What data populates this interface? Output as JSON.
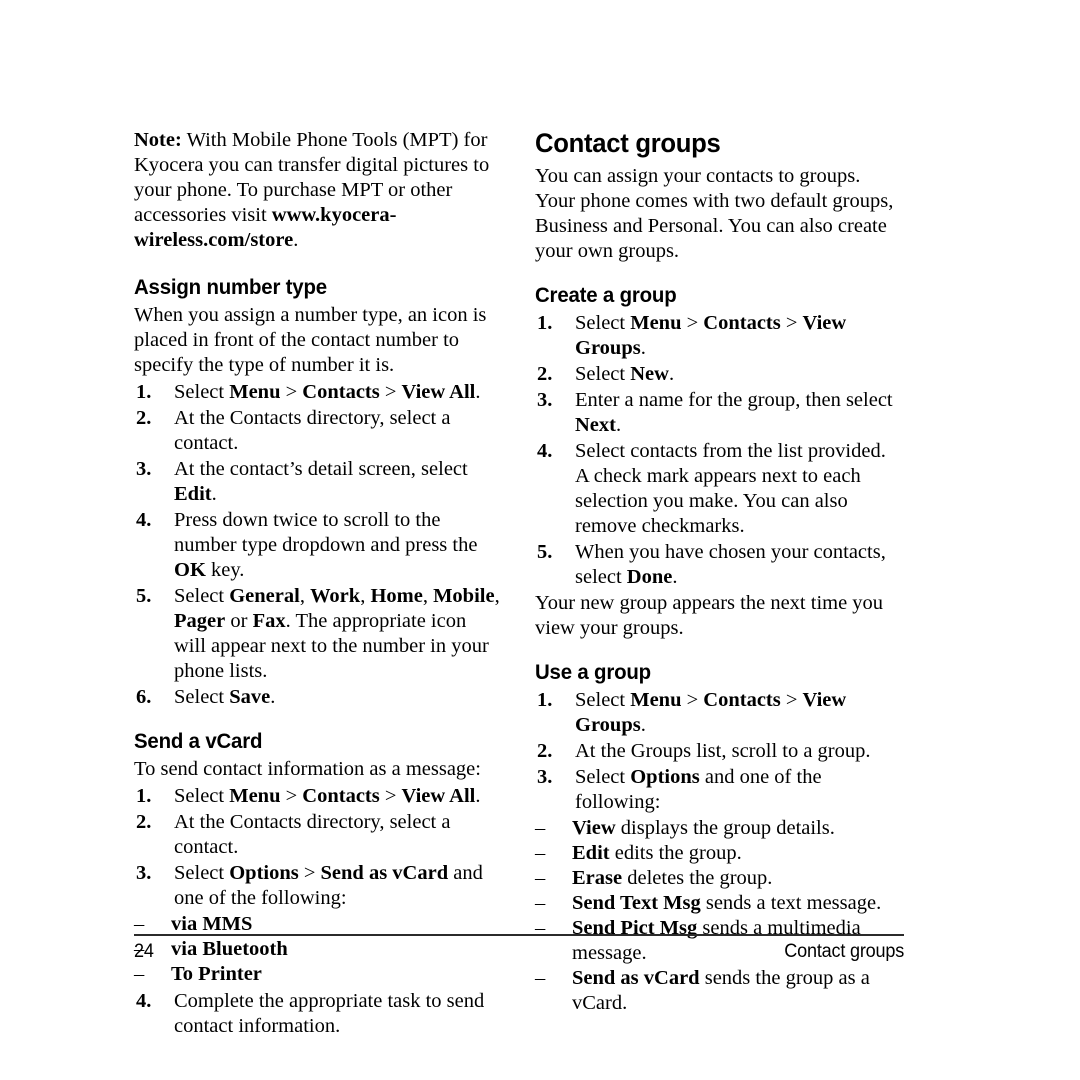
{
  "page": {
    "number": "24",
    "running_head": "Contact groups"
  },
  "left_column": {
    "note": {
      "label": "Note:",
      "text_before_url": " With Mobile Phone Tools (MPT) for Kyocera you can transfer digital pictures to your phone. To purchase MPT or other accessories visit ",
      "url": "www.kyocera-wireless.com/store",
      "text_after_url": "."
    },
    "assign_number_type": {
      "heading": "Assign number type",
      "intro": "When you assign a number type, an icon is placed in front of the contact number to specify the type of number it is.",
      "steps": [
        {
          "num": "1.",
          "html": "Select <b>Menu</b> > <b>Contacts</b> > <b>View All</b>."
        },
        {
          "num": "2.",
          "html": "At the Contacts directory, select a contact."
        },
        {
          "num": "3.",
          "html": "At the contact’s detail screen, select <b>Edit</b>."
        },
        {
          "num": "4.",
          "html": "Press down twice to scroll to the number type dropdown and press the <b>OK</b> key."
        },
        {
          "num": "5.",
          "html": "Select <b>General</b>, <b>Work</b>, <b>Home</b>, <b>Mobile</b>, <b>Pager</b> or <b>Fax</b>. The appropriate icon will appear next to the number in your phone lists."
        },
        {
          "num": "6.",
          "html": "Select <b>Save</b>."
        }
      ]
    },
    "send_a_vcard": {
      "heading": "Send a vCard",
      "intro": "To send contact information as a message:",
      "steps": [
        {
          "num": "1.",
          "html": "Select <b>Menu</b> > <b>Contacts</b> > <b>View All</b>."
        },
        {
          "num": "2.",
          "html": "At the Contacts directory, select a contact."
        },
        {
          "num": "3.",
          "html": "Select <b>Options</b> > <b>Send as vCard</b> and one of the following:"
        }
      ],
      "sub_options": [
        {
          "dash": "–",
          "html": "<b>via MMS</b>"
        },
        {
          "dash": "–",
          "html": "<b>via Bluetooth</b>"
        },
        {
          "dash": "–",
          "html": "<b>To Printer</b>"
        }
      ],
      "final_step": {
        "num": "4.",
        "html": "Complete the appropriate task to send contact information."
      }
    }
  },
  "right_column": {
    "title": "Contact groups",
    "intro": "You can assign your contacts to groups. Your phone comes with two default groups, Business and Personal. You can also create your own groups.",
    "create_a_group": {
      "heading": "Create a group",
      "steps": [
        {
          "num": "1.",
          "html": "Select <b>Menu</b> > <b>Contacts</b> > <b>View Groups</b>."
        },
        {
          "num": "2.",
          "html": "Select <b>New</b>."
        },
        {
          "num": "3.",
          "html": "Enter a name for the group, then select <b>Next</b>."
        },
        {
          "num": "4.",
          "html": "Select contacts from the list provided. A check mark appears next to each selection you make. You can also remove checkmarks."
        },
        {
          "num": "5.",
          "html": "When you have chosen your contacts, select <b>Done</b>."
        }
      ],
      "closing": "Your new group appears the next time you view your groups."
    },
    "use_a_group": {
      "heading": "Use a group",
      "steps": [
        {
          "num": "1.",
          "html": "Select <b>Menu</b> > <b>Contacts</b> > <b>View Groups</b>."
        },
        {
          "num": "2.",
          "html": "At the Groups list, scroll to a group."
        },
        {
          "num": "3.",
          "html": "Select <b>Options</b> and one of the following:"
        }
      ],
      "sub_options": [
        {
          "dash": "–",
          "html": "<b>View</b> displays the group details."
        },
        {
          "dash": "–",
          "html": "<b>Edit</b> edits the group."
        },
        {
          "dash": "–",
          "html": "<b>Erase</b> deletes the group."
        },
        {
          "dash": "–",
          "html": "<b>Send Text Msg</b> sends a text message."
        },
        {
          "dash": "–",
          "html": "<b>Send Pict Msg</b> sends a multimedia message."
        },
        {
          "dash": "–",
          "html": "<b>Send as vCard</b> sends the group as a vCard."
        }
      ]
    }
  }
}
